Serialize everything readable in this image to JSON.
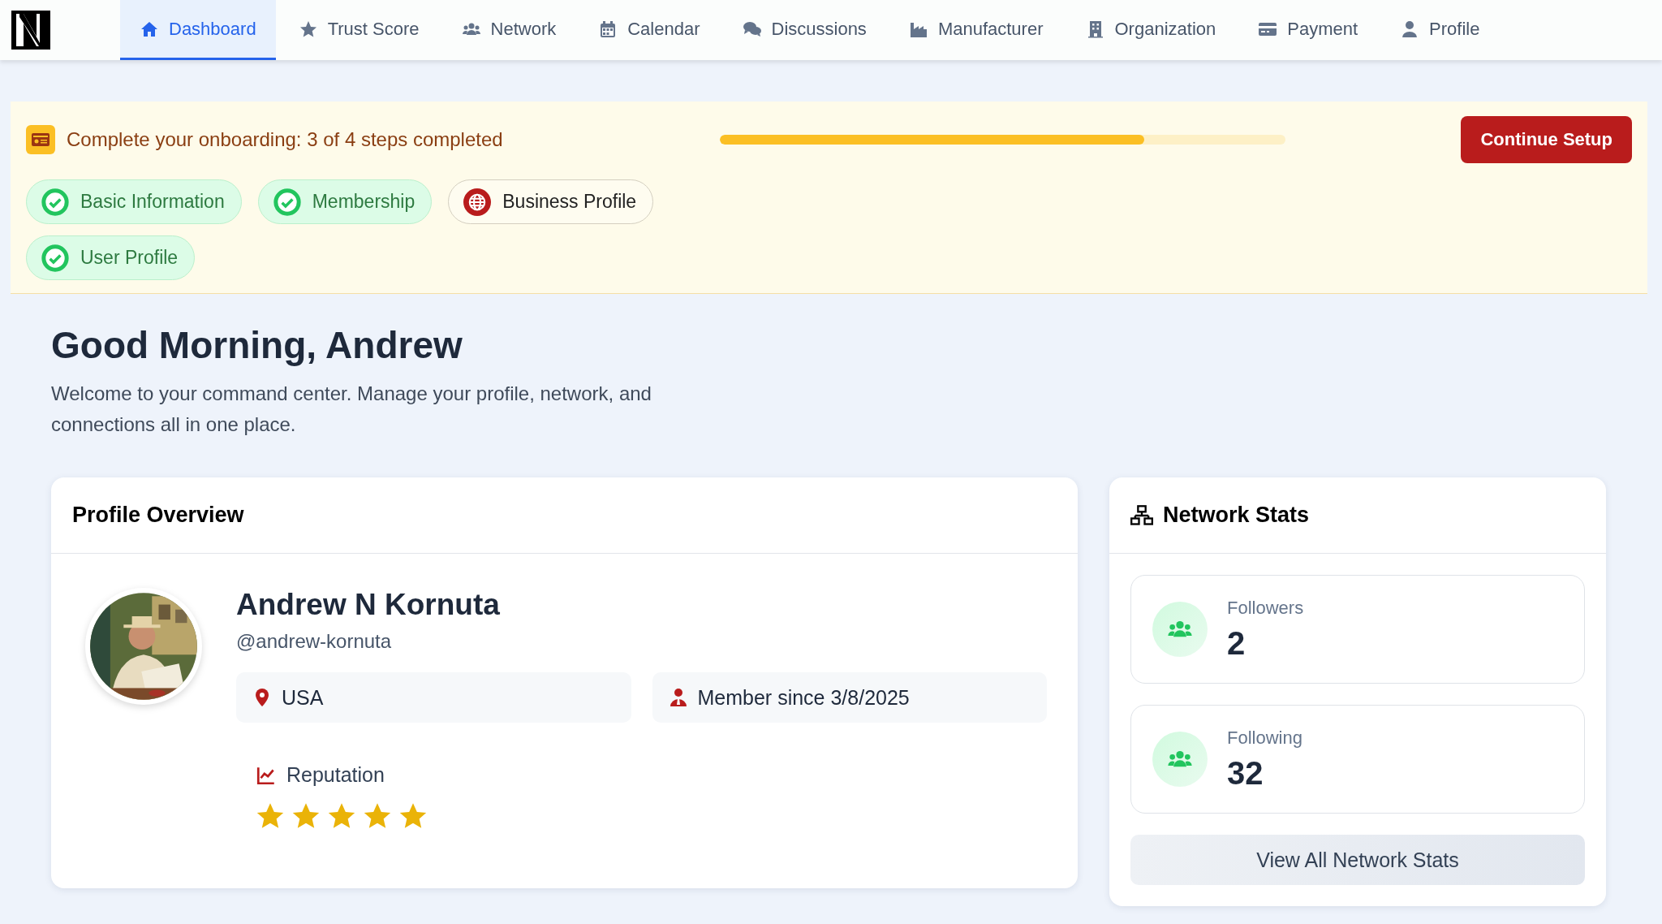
{
  "nav": {
    "tabs": [
      {
        "label": "Dashboard",
        "selected": true
      },
      {
        "label": "Trust Score",
        "selected": false
      },
      {
        "label": "Network",
        "selected": false
      },
      {
        "label": "Calendar",
        "selected": false
      },
      {
        "label": "Discussions",
        "selected": false
      },
      {
        "label": "Manufacturer",
        "selected": false
      },
      {
        "label": "Organization",
        "selected": false
      },
      {
        "label": "Payment",
        "selected": false
      },
      {
        "label": "Profile",
        "selected": false
      }
    ]
  },
  "onboarding": {
    "title": "Complete your onboarding: 3 of 4 steps completed",
    "level": 0.75,
    "button": "Continue Setup",
    "steps": [
      {
        "label": "Basic Information",
        "completed": true
      },
      {
        "label": "Membership",
        "completed": true
      },
      {
        "label": "Business Profile",
        "completed": false
      },
      {
        "label": "User Profile",
        "completed": true
      }
    ]
  },
  "greeting": {
    "title": "Good Morning, Andrew",
    "subtitle": "Welcome to your command center. Manage your profile, network, and connections all in one place."
  },
  "profile_overview": {
    "title": "Profile Overview",
    "name": "Andrew N Kornuta",
    "handle": "@andrew-kornuta",
    "facts": [
      {
        "kind": "location",
        "text": "USA"
      },
      {
        "kind": "member",
        "text": "Member since 3/8/2025"
      }
    ],
    "reputation": {
      "label": "Reputation",
      "stars": 5
    }
  },
  "network_stats": {
    "title": "Network Stats",
    "stats": [
      {
        "label": "Followers",
        "value": "2"
      },
      {
        "label": "Following",
        "value": "32"
      }
    ],
    "button": "View All Network Stats"
  }
}
